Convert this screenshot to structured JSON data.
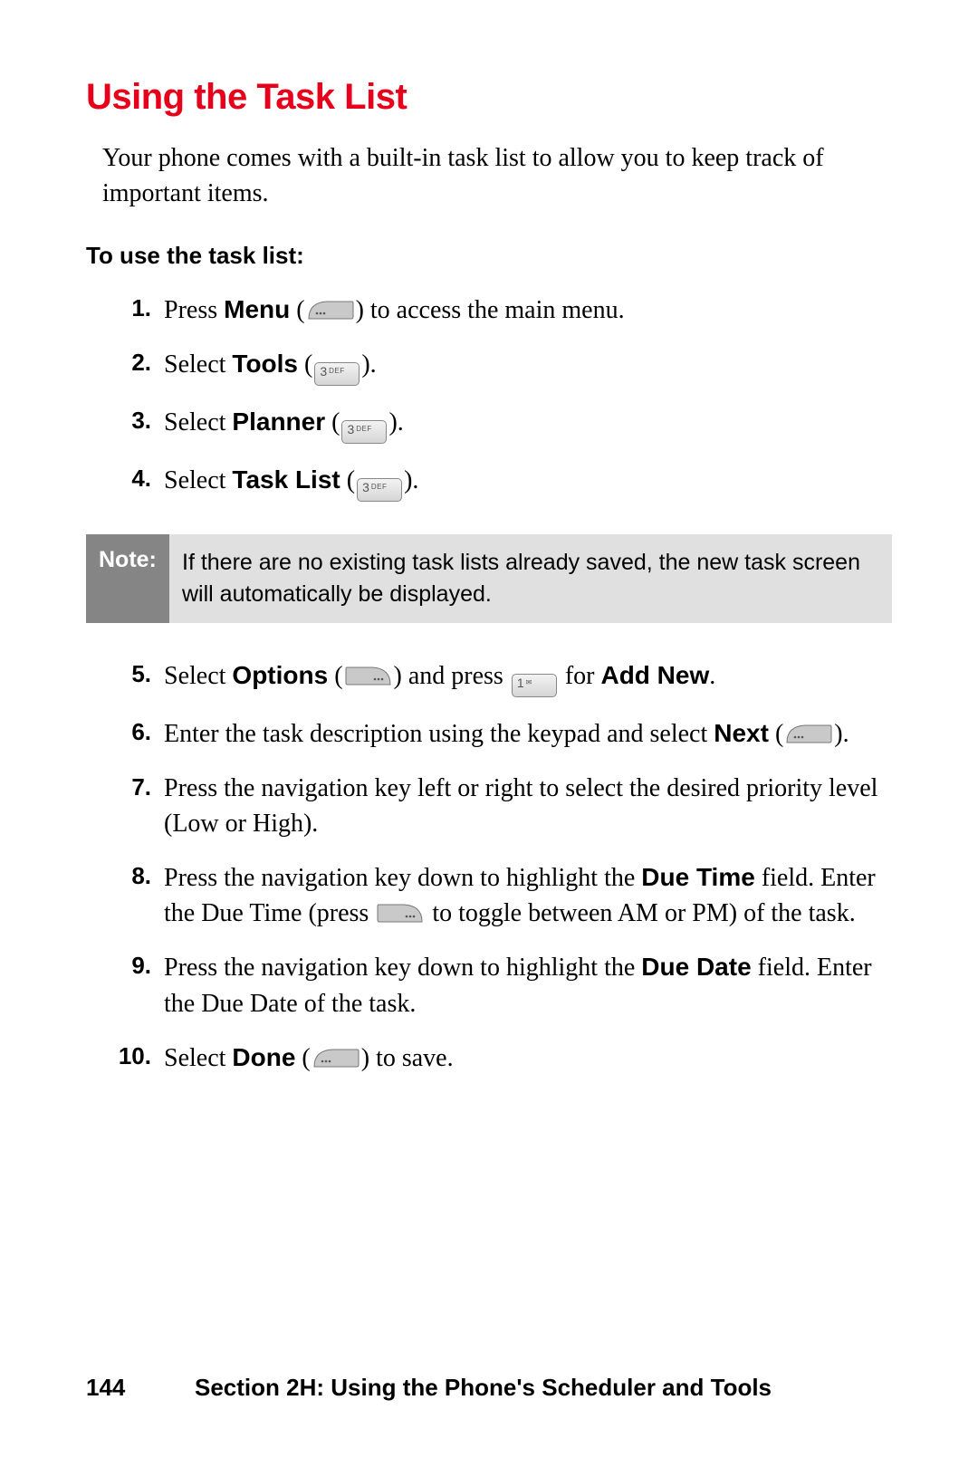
{
  "title": "Using the Task List",
  "intro": "Your phone comes with a built-in task list to allow you to keep track of important items.",
  "subhead": "To use the task list:",
  "steps": [
    {
      "n": "1.",
      "a": "Press ",
      "b": "Menu",
      "c": " (",
      "d": ") to access the main menu."
    },
    {
      "n": "2.",
      "a": "Select ",
      "b": "Tools",
      "c": " (",
      "d": ")."
    },
    {
      "n": "3.",
      "a": "Select ",
      "b": "Planner",
      "c": " (",
      "d": ")."
    },
    {
      "n": "4.",
      "a": "Select ",
      "b": "Task List",
      "c": " (",
      "d": ")."
    }
  ],
  "note_label": "Note:",
  "note_text": "If there are no existing task lists already saved, the new task screen will automatically be displayed.",
  "steps2": {
    "s5": {
      "n": "5.",
      "a": "Select ",
      "b": "Options",
      "c": " (",
      "d": ") and press ",
      "e": " for ",
      "f": "Add New",
      "g": "."
    },
    "s6": {
      "n": "6.",
      "a": "Enter the task description using the keypad and select ",
      "b": "Next",
      "c": " (",
      "d": ")."
    },
    "s7": {
      "n": "7.",
      "a": "Press the navigation key left or right to select the desired priority level (Low or High)."
    },
    "s8": {
      "n": "8.",
      "a": "Press the navigation key down to highlight the ",
      "b": "Due Time",
      "c": " field. Enter the Due Time (press ",
      "d": " to toggle between AM or PM) of the task."
    },
    "s9": {
      "n": "9.",
      "a": "Press the navigation key down to highlight the ",
      "b": "Due Date",
      "c": " field. Enter the Due Date of the task."
    },
    "s10": {
      "n": "10.",
      "a": "Select ",
      "b": "Done",
      "c": " (",
      "d": ") to save."
    }
  },
  "keys": {
    "k3": "3",
    "k3sup": "DEF",
    "k1": "1",
    "k1sup": "✉"
  },
  "footer": {
    "page": "144",
    "section": "Section 2H: Using the Phone's Scheduler and Tools"
  }
}
